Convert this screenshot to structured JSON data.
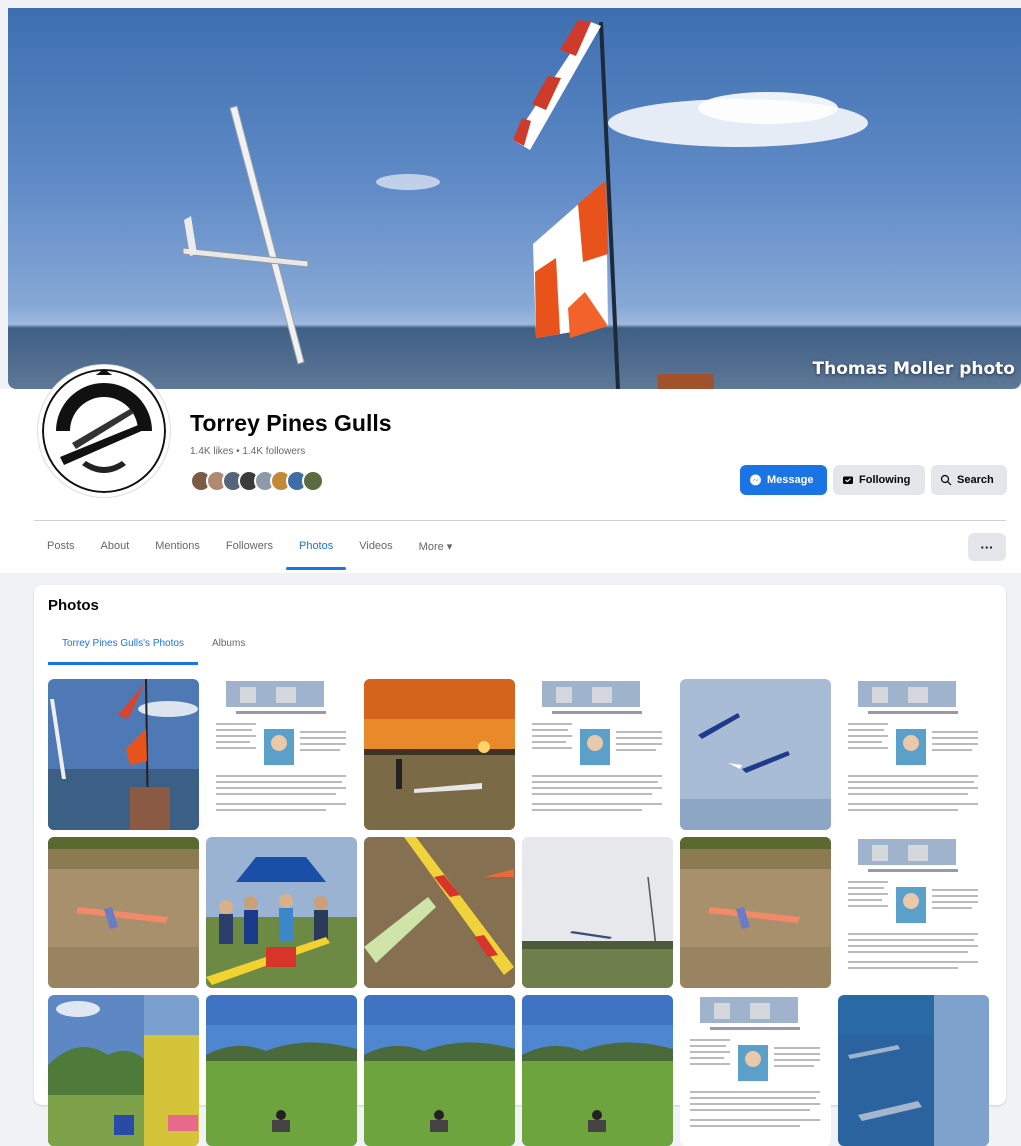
{
  "cover": {
    "credit": "Thomas Moller photo"
  },
  "page": {
    "name": "Torrey Pines Gulls",
    "stats": "1.4K likes • 1.4K followers",
    "follower_face_colors": [
      "#7a5c46",
      "#b08a70",
      "#56657a",
      "#3b3b3b",
      "#8d9aa8",
      "#c28a38",
      "#3f6da6",
      "#5b6b3f"
    ]
  },
  "actions": {
    "message": "Message",
    "following": "Following",
    "search": "Search"
  },
  "nav": {
    "tabs": [
      "Posts",
      "About",
      "Mentions",
      "Followers",
      "Photos",
      "Videos",
      "More ▾"
    ],
    "active": "Photos",
    "more_menu": "···"
  },
  "photos": {
    "title": "Photos",
    "subtabs": [
      "Torrey Pines Gulls's Photos",
      "Albums"
    ],
    "active_subtab": "Torrey Pines Gulls's Photos",
    "tiles": [
      "windsock",
      "newsletter",
      "sunset",
      "newsletter",
      "gliders-sky",
      "newsletter",
      "glider-field",
      "group",
      "glider-ground",
      "sky-antenna",
      "glider-field",
      "newsletter",
      "hills-flowers",
      "field",
      "field",
      "field",
      "newsletter",
      "ocean"
    ]
  },
  "colors": {
    "accent": "#1b74e4",
    "secondary_button": "#e4e6eb",
    "page_bg": "#f0f2f5"
  }
}
